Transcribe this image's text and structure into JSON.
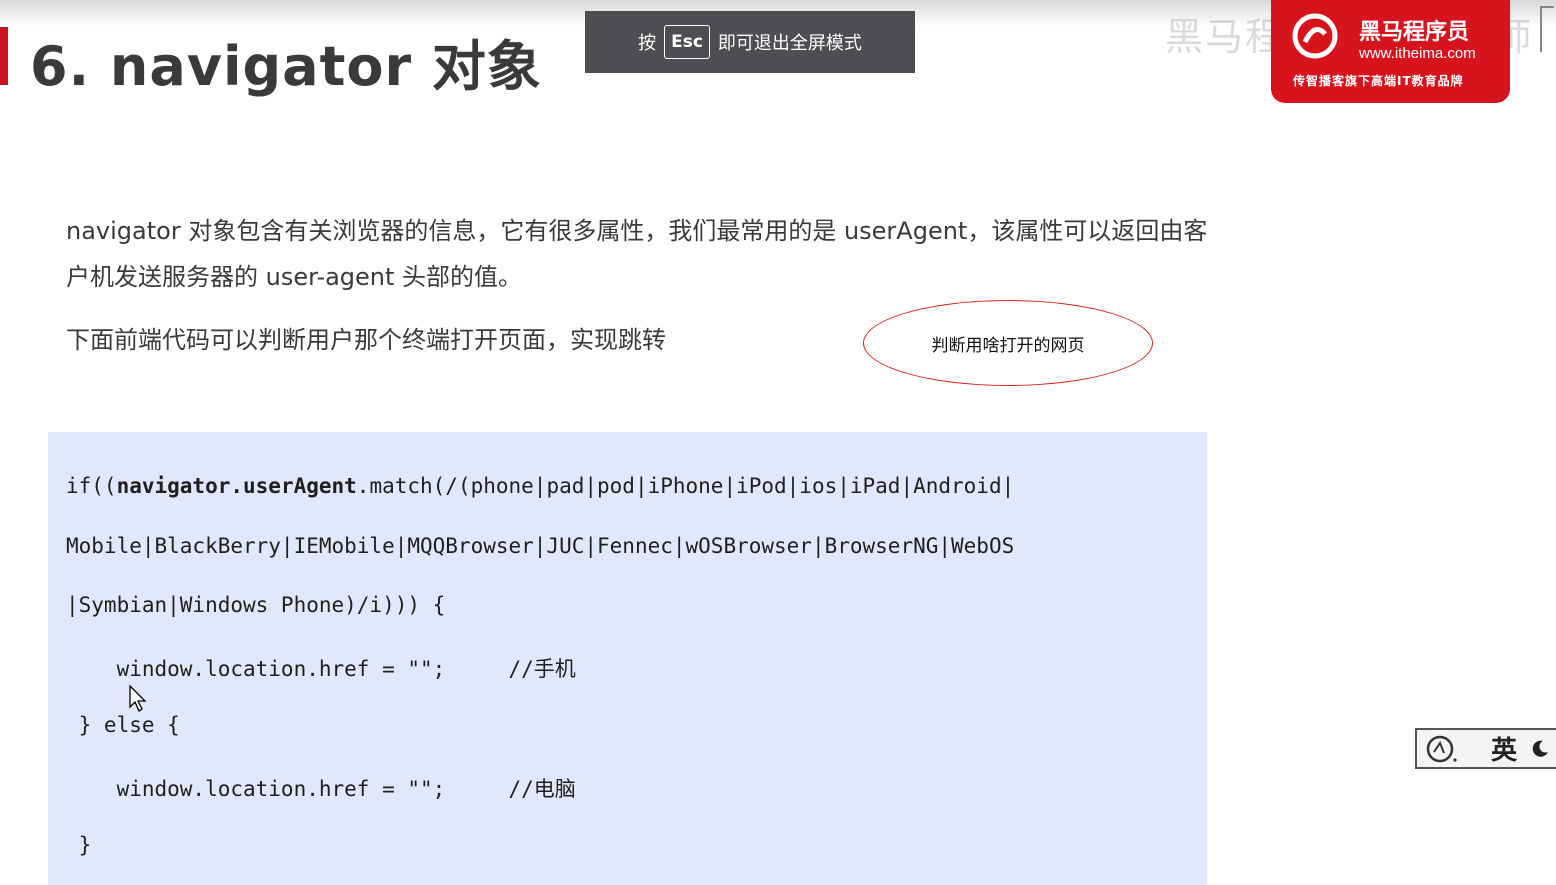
{
  "slide": {
    "title": "6. navigator 对象"
  },
  "fullscreen_hint": {
    "prefix": "按",
    "key": "Esc",
    "suffix": "即可退出全屏模式"
  },
  "watermark": "黑马程序员pink老师",
  "logo": {
    "name": "黑马程序员",
    "url": "www.itheima.com",
    "slogan": "传智播客旗下高端IT教育品牌"
  },
  "content": {
    "para1_line1": "navigator 对象包含有关浏览器的信息，它有很多属性，我们最常用的是 userAgent，该属性可以返回由客",
    "para1_line2": "户机发送服务器的 user-agent 头部的值。",
    "para2": "下面前端代码可以判断用户那个终端打开页面，实现跳转",
    "annotation": "判断用啥打开的网页"
  },
  "code": {
    "line1_a": "if((",
    "line1_b": "navigator.userAgent",
    "line1_c": ".match(/(phone|pad|pod|iPhone|iPod|ios|iPad|Android|",
    "line2": "Mobile|BlackBerry|IEMobile|MQQBrowser|JUC|Fennec|wOSBrowser|BrowserNG|WebOS",
    "line3": "|Symbian|Windows Phone)/i))) {",
    "line4": "    window.location.href = \"\";     //手机",
    "line5": " } else {",
    "line6": "    window.location.href = \"\";     //电脑",
    "line7": " }"
  },
  "ime": {
    "label": "英"
  },
  "colors": {
    "brand_red": "#d7141d",
    "code_bg": "#dfe9fb",
    "hint_bg": "#4e4e52"
  }
}
